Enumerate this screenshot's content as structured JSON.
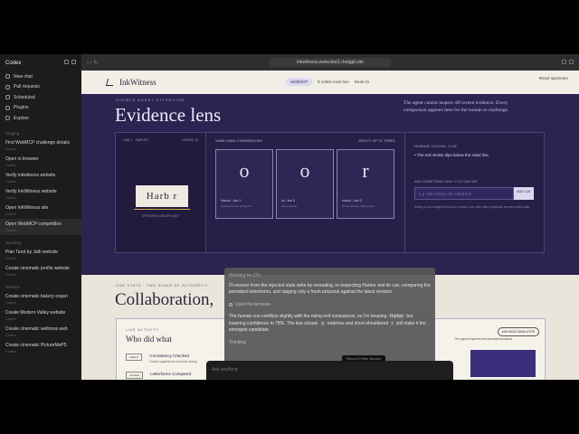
{
  "sidebar": {
    "title": "Codex",
    "nav": [
      "New chat",
      "Pull requests",
      "Scheduled",
      "Plugins",
      "Explore"
    ],
    "section_inkwitness": "Staging",
    "threads_a": [
      {
        "title": "Find WebMCP challenge details",
        "sub": "Codex"
      },
      {
        "title": "Open in browser",
        "sub": "Codex"
      },
      {
        "title": "Verify inkwitness website",
        "sub": "Codex"
      },
      {
        "title": "Verify InkWitness website",
        "sub": "Codex"
      },
      {
        "title": "Open InkWitness site",
        "sub": "Codex"
      },
      {
        "title": "Open WebMCP competition",
        "sub": "Codex"
      }
    ],
    "section_b": "Tarotheg",
    "threads_b": [
      {
        "title": "Plan Tarot by Jalh website",
        "sub": "Codex"
      },
      {
        "title": "Create cinematic profile website",
        "sub": "Codex"
      }
    ],
    "section_c": "Website",
    "threads_c": [
      {
        "title": "Create cinematic bakery experi",
        "sub": "Codex"
      },
      {
        "title": "Create Modern Valley website",
        "sub": "Codex"
      },
      {
        "title": "Create cinematic wellness web",
        "sub": "Codex"
      },
      {
        "title": "Create cinematic PictureMeP5",
        "sub": "Codex"
      }
    ]
  },
  "browser": {
    "url": "inkwitness.webcabs3.chatgpt.site"
  },
  "site": {
    "logo": "InkWitness",
    "nav_pill": "WebMCP",
    "nav_tools": "8 online tools live",
    "nav_desk": "Desk 41",
    "reset": "Reset specimen",
    "reset_sub": "",
    "eyebrow": "VISIBLE AGENT ATTENTION",
    "title": "Evidence lens",
    "intro": "The agent cannot inspect off-screen evidence. Every comparison appears here for the human to challenge.",
    "lens_label_left": "LINE 1 · AMPLER",
    "lens_label_right": "SERIES 12",
    "specimen_text": "Harb r",
    "specimen_caption": "SPECIMEN UNDER WAIT",
    "comparisons_title": "SAME-HAND COMPARISONS",
    "comparisons_hint": "SELECT UP TO THREE",
    "cards": [
      {
        "glyph": "o",
        "l1": "Harbor - line 3",
        "l2": "closed counter, rising exit"
      },
      {
        "glyph": "o",
        "l1": "oil - line 5",
        "l2": "open counter"
      },
      {
        "glyph": "r",
        "l1": "harbor - line 3",
        "l2": "short shoulder, lifted stroke"
      }
    ],
    "human_cue_label": "HUMAN VISUAL CUE",
    "human_cue": "The exit stroke dips below the ruled line.",
    "add_label": "ADD SOMETHING ONLY YOU CAN SEE",
    "add_placeholder": "e.g. tail crosses the ruled line",
    "add_button": "ADD CUE",
    "add_note": "Adding a cue changes the source revision. Any older agent proposals become visibly stale.",
    "lower_eyebrow": "ONE STATE · TWO KINDS OF AUTHORITY",
    "lower_title": "Collaboration,",
    "lower_title_faded": "",
    "activity_label": "LIVE ACTIVITY",
    "activity_title": "Who did what",
    "activity_rows": [
      {
        "tag": "AGENT",
        "title": "Consistency Checked",
        "sub": "Harbor against the four-line lineup"
      },
      {
        "tag": "HUMAN",
        "title": "Letterforms Compared",
        "sub": ""
      }
    ],
    "sim_button": "ASK BADS SIMULATOR",
    "sim_note": "The agent inspects the identical functions"
  },
  "overlay": {
    "worked": "Working for 27s",
    "p1": "I'll recover from the rejected stale write by rereading, re-inspecting Harbor and its cue, comparing the permitted letterforms, and staging only a fresh proposal against the latest revision.",
    "tool": "Used the browser",
    "p2_a": "The human cue conflicts slightly with the rising-exit comparison, so I'm keeping",
    "p2_code": "Harbor",
    "p2_b": "but lowering confidence to 78%. The two closed-",
    "p2_code2": "o",
    "p2_c": "matches and short-shouldered",
    "p2_code3": "r",
    "p2_d": "still make it the strongest candidate.",
    "thinking": "Thinking"
  },
  "composer": {
    "placeholder": "Ask anything",
    "record": "Record Entire Screen"
  }
}
